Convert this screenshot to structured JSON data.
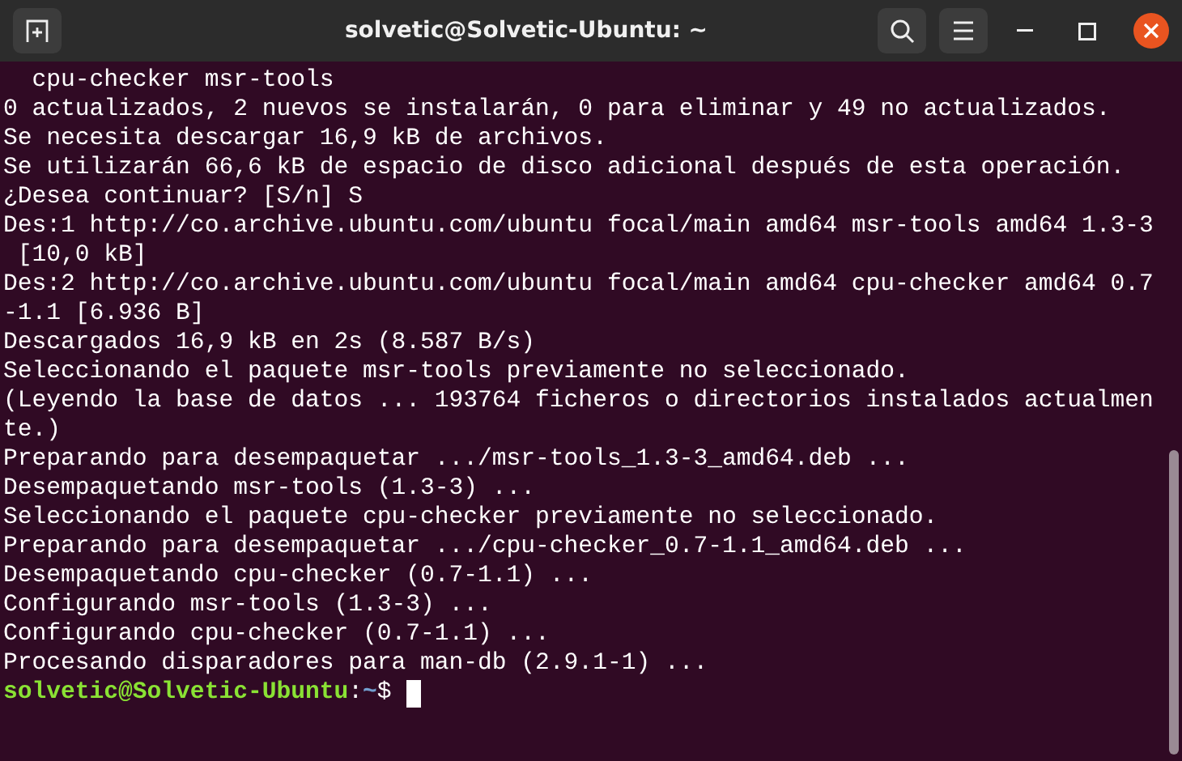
{
  "window": {
    "title": "solvetic@Solvetic-Ubuntu: ~"
  },
  "terminal": {
    "lines": [
      "  cpu-checker msr-tools",
      "0 actualizados, 2 nuevos se instalarán, 0 para eliminar y 49 no actualizados.",
      "Se necesita descargar 16,9 kB de archivos.",
      "Se utilizarán 66,6 kB de espacio de disco adicional después de esta operación.",
      "¿Desea continuar? [S/n] S",
      "Des:1 http://co.archive.ubuntu.com/ubuntu focal/main amd64 msr-tools amd64 1.3-3",
      " [10,0 kB]",
      "Des:2 http://co.archive.ubuntu.com/ubuntu focal/main amd64 cpu-checker amd64 0.7",
      "-1.1 [6.936 B]",
      "Descargados 16,9 kB en 2s (8.587 B/s)",
      "Seleccionando el paquete msr-tools previamente no seleccionado.",
      "(Leyendo la base de datos ... 193764 ficheros o directorios instalados actualmen",
      "te.)",
      "Preparando para desempaquetar .../msr-tools_1.3-3_amd64.deb ...",
      "Desempaquetando msr-tools (1.3-3) ...",
      "Seleccionando el paquete cpu-checker previamente no seleccionado.",
      "Preparando para desempaquetar .../cpu-checker_0.7-1.1_amd64.deb ...",
      "Desempaquetando cpu-checker (0.7-1.1) ...",
      "Configurando msr-tools (1.3-3) ...",
      "Configurando cpu-checker (0.7-1.1) ...",
      "Procesando disparadores para man-db (2.9.1-1) ..."
    ],
    "prompt": {
      "user_host": "solvetic@Solvetic-Ubuntu",
      "separator": ":",
      "path": "~",
      "symbol": "$"
    }
  }
}
